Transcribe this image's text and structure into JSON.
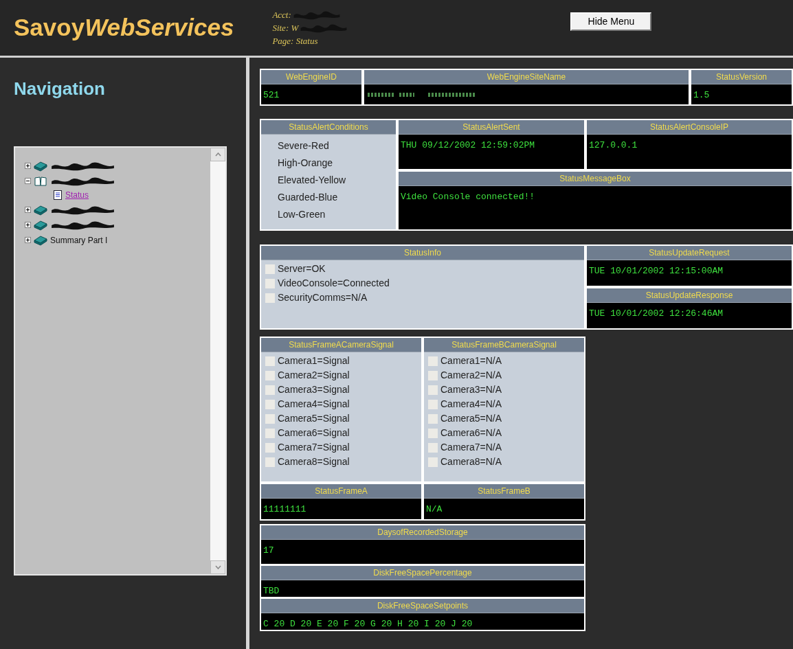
{
  "header": {
    "logo_plain": "Savoy",
    "logo_italic": "WebServices",
    "info": [
      {
        "text": "Acct:",
        "redacted": true
      },
      {
        "text": "Site: W",
        "redacted": true
      },
      {
        "text": "Page: Status",
        "redacted": false
      }
    ],
    "hide_menu_button": "Hide Menu"
  },
  "navigation": {
    "title": "Navigation",
    "tree": [
      {
        "kind": "redacted",
        "expanded": false
      },
      {
        "kind": "redacted",
        "expanded": true,
        "children": [
          {
            "label": "Status"
          }
        ]
      },
      {
        "kind": "redacted",
        "expanded": false
      },
      {
        "kind": "redacted",
        "expanded": false
      },
      {
        "kind": "named",
        "label": "Summary Part I",
        "expanded": false
      }
    ]
  },
  "engine_row": [
    {
      "label": "WebEngineID",
      "kind": "text",
      "value": "521"
    },
    {
      "label": "WebEngineSiteName",
      "kind": "redacted"
    },
    {
      "label": "StatusVersion",
      "kind": "text",
      "value": "1.5"
    }
  ],
  "alert_conditions": {
    "label": "StatusAlertConditions",
    "items": [
      "Severe-Red",
      "High-Orange",
      "Elevated-Yellow",
      "Guarded-Blue",
      "Low-Green"
    ]
  },
  "alert_sent": {
    "label": "StatusAlertSent",
    "value": "THU 09/12/2002 12:59:02PM"
  },
  "alert_console_ip": {
    "label": "StatusAlertConsoleIP",
    "value": "127.0.0.1"
  },
  "message_box": {
    "label": "StatusMessageBox",
    "value": "Video Console connected!!"
  },
  "status_info": {
    "label": "StatusInfo",
    "items": [
      {
        "text": "Server=OK",
        "checked": false
      },
      {
        "text": "VideoConsole=Connected",
        "checked": false
      },
      {
        "text": "SecurityComms=N/A",
        "checked": false
      }
    ]
  },
  "update_request": {
    "label": "StatusUpdateRequest",
    "value": "TUE 10/01/2002 12:15:00AM"
  },
  "update_response": {
    "label": "StatusUpdateResponse",
    "value": "TUE 10/01/2002 12:26:46AM"
  },
  "camera_signals": [
    {
      "label": "StatusFrameACameraSignal",
      "items": [
        {
          "text": "Camera1=Signal",
          "checked": false
        },
        {
          "text": "Camera2=Signal",
          "checked": false
        },
        {
          "text": "Camera3=Signal",
          "checked": false
        },
        {
          "text": "Camera4=Signal",
          "checked": false
        },
        {
          "text": "Camera5=Signal",
          "checked": false
        },
        {
          "text": "Camera6=Signal",
          "checked": false
        },
        {
          "text": "Camera7=Signal",
          "checked": false
        },
        {
          "text": "Camera8=Signal",
          "checked": false
        }
      ]
    },
    {
      "label": "StatusFrameBCameraSignal",
      "items": [
        {
          "text": "Camera1=N/A",
          "checked": false
        },
        {
          "text": "Camera2=N/A",
          "checked": false
        },
        {
          "text": "Camera3=N/A",
          "checked": false
        },
        {
          "text": "Camera4=N/A",
          "checked": false
        },
        {
          "text": "Camera5=N/A",
          "checked": false
        },
        {
          "text": "Camera6=N/A",
          "checked": false
        },
        {
          "text": "Camera7=N/A",
          "checked": false
        },
        {
          "text": "Camera8=N/A",
          "checked": false
        }
      ]
    }
  ],
  "frames": [
    {
      "label": "StatusFrameA",
      "value": "11111111"
    },
    {
      "label": "StatusFrameB",
      "value": "N/A"
    }
  ],
  "storage": [
    {
      "label": "DaysofRecordedStorage",
      "value": "17"
    },
    {
      "label": "DiskFreeSpacePercentage",
      "value": "TBD"
    },
    {
      "label": "DiskFreeSpaceSetpoints",
      "value": "C 20 D 20 E 20 F 20 G 20 H 20 I 20 J 20"
    }
  ]
}
